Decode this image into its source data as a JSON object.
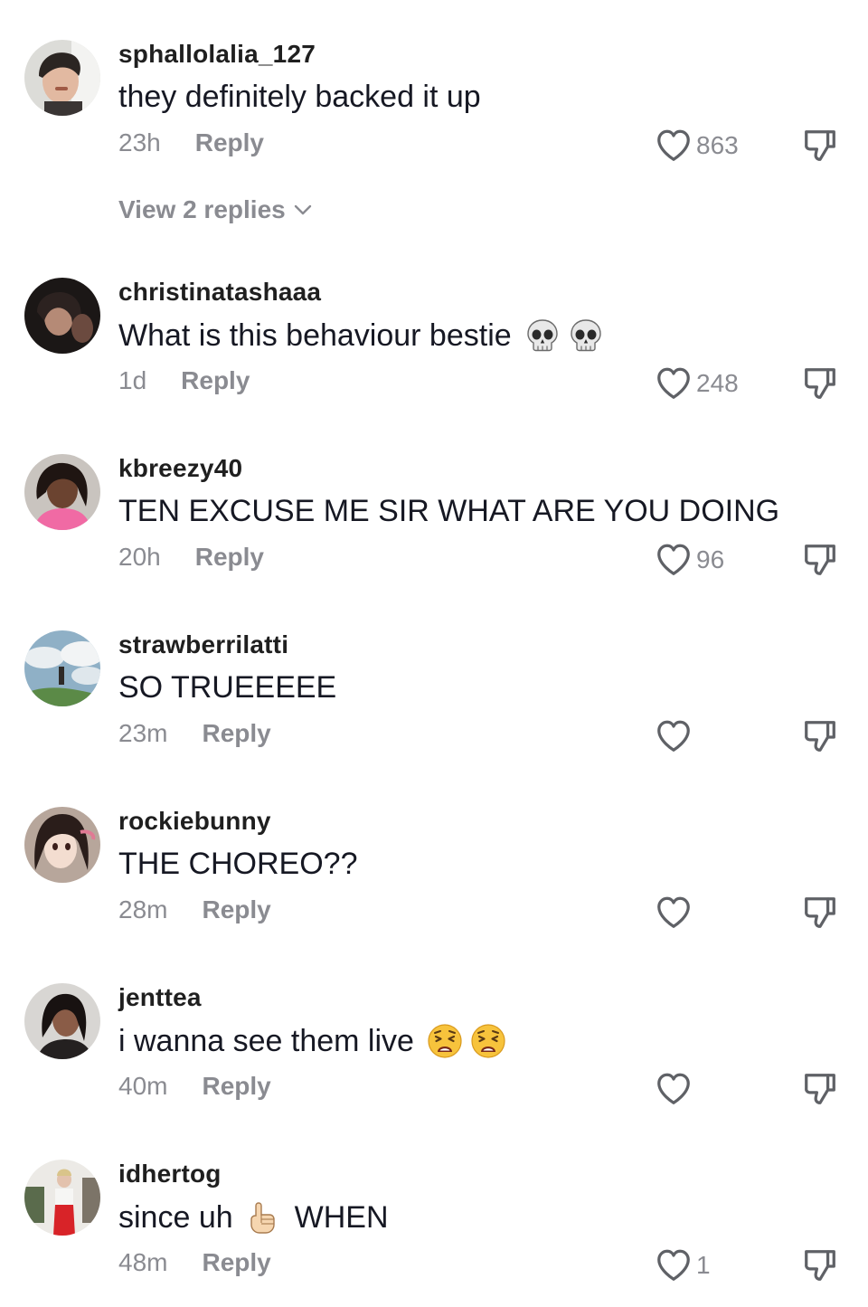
{
  "comments": [
    {
      "username": "sphallolalia_127",
      "text": "they definitely backed it up",
      "time": "23h",
      "reply_label": "Reply",
      "likes": "863",
      "view_replies": "View 2 replies"
    },
    {
      "username": "christinatashaaa",
      "text": "What is this behaviour bestie",
      "emojis": [
        "skull-emoji",
        "skull-emoji"
      ],
      "time": "1d",
      "reply_label": "Reply",
      "likes": "248"
    },
    {
      "username": "kbreezy40",
      "text": "TEN EXCUSE ME SIR WHAT ARE YOU DOING",
      "time": "20h",
      "reply_label": "Reply",
      "likes": "96"
    },
    {
      "username": "strawberrilatti",
      "text": "SO TRUEEEEE",
      "time": "23m",
      "reply_label": "Reply",
      "likes": ""
    },
    {
      "username": "rockiebunny",
      "text": "THE CHOREO??",
      "time": "28m",
      "reply_label": "Reply",
      "likes": ""
    },
    {
      "username": "jenttea",
      "text": "i wanna see them live",
      "emojis": [
        "weary-face-emoji",
        "weary-face-emoji"
      ],
      "time": "40m",
      "reply_label": "Reply",
      "likes": ""
    },
    {
      "username": "idhertog",
      "text_before": "since uh",
      "text_after": "WHEN",
      "emojis": [
        "pointing-up-emoji"
      ],
      "time": "48m",
      "reply_label": "Reply",
      "likes": "1"
    }
  ],
  "icons": {
    "like": "heart-outline-icon",
    "dislike": "thumbs-down-icon",
    "expand": "chevron-down-icon"
  },
  "colors": {
    "text": "#161823",
    "muted": "#8a8b91",
    "icon": "#5f6166"
  }
}
